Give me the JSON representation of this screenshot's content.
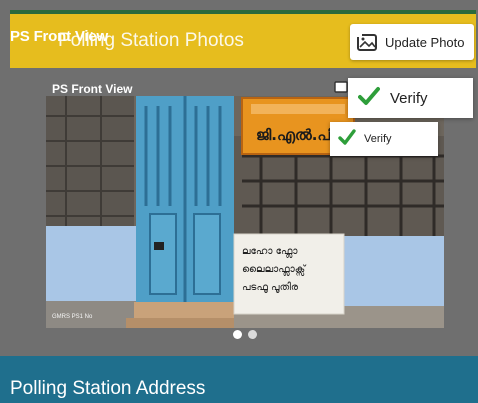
{
  "header": {
    "title": "Polling Station Photos",
    "overlay_label": "PS Front View",
    "update_button_label": "Update Photo",
    "update_button_icon": "photo-frame-icon"
  },
  "photo": {
    "caption": "PS Front View",
    "sign_board_text": "ജി.എൽ.പി.",
    "notice_lines": [
      "ലഹോ ഫ്ലോ",
      "ലൈലാഫ്ലാക്സ്",
      "പടഫൂ പൂതിര"
    ],
    "watermark": "GMRS PS1 No"
  },
  "verify_popups": [
    {
      "label": "Verify",
      "icon": "check-icon"
    },
    {
      "label": "Verify",
      "icon": "check-icon"
    }
  ],
  "pager": {
    "count": 2,
    "active_index": 0
  },
  "address": {
    "title": "Polling Station Address"
  },
  "colors": {
    "header_yellow": "#e6bd1e",
    "frame_gray": "#6f6f6f",
    "address_blue": "#1f6f8d",
    "check_green": "#2e9e3a"
  }
}
